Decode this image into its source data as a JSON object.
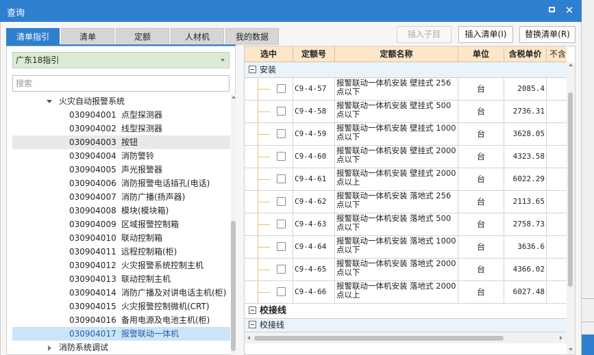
{
  "window": {
    "title": "查询"
  },
  "tabs": [
    {
      "label": "清单指引",
      "active": true
    },
    {
      "label": "清单",
      "active": false
    },
    {
      "label": "定额",
      "active": false
    },
    {
      "label": "人材机",
      "active": false
    },
    {
      "label": "我的数据",
      "active": false
    }
  ],
  "toolbar": {
    "insert_child": "插入子目",
    "insert_list": "插入清单(I)",
    "replace_list": "替换清单(R)"
  },
  "left": {
    "guide_select": "广东18指引",
    "search_placeholder": "搜索",
    "tree_parent": "火灾自动报警系统",
    "tree_items": [
      {
        "code": "030904001",
        "name": "点型探测器"
      },
      {
        "code": "030904002",
        "name": "线型探测器"
      },
      {
        "code": "030904003",
        "name": "按钮"
      },
      {
        "code": "030904004",
        "name": "消防警铃"
      },
      {
        "code": "030904005",
        "name": "声光报警器"
      },
      {
        "code": "030904006",
        "name": "消防报警电话插孔(电话)"
      },
      {
        "code": "030904007",
        "name": "消防广播(扬声器)"
      },
      {
        "code": "030904008",
        "name": "模块(模块箱)"
      },
      {
        "code": "030904009",
        "name": "区域报警控制箱"
      },
      {
        "code": "030904010",
        "name": "联动控制箱"
      },
      {
        "code": "030904011",
        "name": "远程控制箱(柜)"
      },
      {
        "code": "030904012",
        "name": "火灾报警系统控制主机"
      },
      {
        "code": "030904013",
        "name": "联动控制主机"
      },
      {
        "code": "030904014",
        "name": "消防广播及对讲电话主机(柜)"
      },
      {
        "code": "030904015",
        "name": "火灾报警控制微机(CRT)"
      },
      {
        "code": "030904016",
        "name": "备用电源及电池主机(柜)"
      },
      {
        "code": "030904017",
        "name": "报警联动一体机"
      }
    ],
    "tree_next": "消防系统调试"
  },
  "grid": {
    "headers": {
      "select": "选中",
      "code": "定额号",
      "name": "定额名称",
      "unit": "单位",
      "price": "含税单价",
      "extra": "不含"
    },
    "group_install": "安装",
    "rows": [
      {
        "code": "C9-4-57",
        "name": "报警联动一体机安装 壁挂式 256点以下",
        "unit": "台",
        "price": "2085.4"
      },
      {
        "code": "C9-4-58",
        "name": "报警联动一体机安装 壁挂式 500点以下",
        "unit": "台",
        "price": "2736.31"
      },
      {
        "code": "C9-4-59",
        "name": "报警联动一体机安装 壁挂式 1000点以下",
        "unit": "台",
        "price": "3628.05"
      },
      {
        "code": "C9-4-60",
        "name": "报警联动一体机安装 壁挂式 2000点以下",
        "unit": "台",
        "price": "4323.58"
      },
      {
        "code": "C9-4-61",
        "name": "报警联动一体机安装 壁挂式 2000点以上",
        "unit": "台",
        "price": "6022.29"
      },
      {
        "code": "C9-4-62",
        "name": "报警联动一体机安装 落地式 256点以下",
        "unit": "台",
        "price": "2113.65"
      },
      {
        "code": "C9-4-63",
        "name": "报警联动一体机安装 落地式 500点以下",
        "unit": "台",
        "price": "2758.73"
      },
      {
        "code": "C9-4-64",
        "name": "报警联动一体机安装 落地式 1000点以下",
        "unit": "台",
        "price": "3636.6"
      },
      {
        "code": "C9-4-65",
        "name": "报警联动一体机安装 落地式 2000点以下",
        "unit": "台",
        "price": "4366.02"
      },
      {
        "code": "C9-4-66",
        "name": "报警联动一体机安装 落地式 2000点以上",
        "unit": "台",
        "price": "6027.48"
      }
    ],
    "group_calib": "校接线",
    "subgroup_calib": "校接线"
  }
}
